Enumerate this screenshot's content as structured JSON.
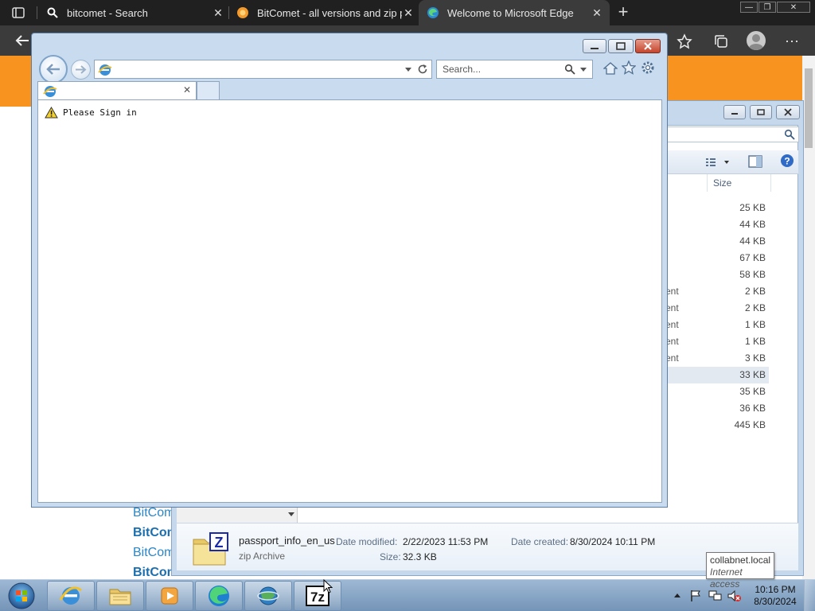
{
  "edge": {
    "tabs": [
      {
        "title": "bitcomet - Search",
        "close": "✕"
      },
      {
        "title": "BitComet - all versions and zip p",
        "close": "✕"
      },
      {
        "title": "Welcome to Microsoft Edge",
        "close": "✕"
      }
    ],
    "new_tab": "+",
    "window_controls": [
      "—",
      "❐",
      "✕"
    ],
    "page_links": [
      {
        "text": "BitCom",
        "bold": false
      },
      {
        "text": "BitCom",
        "bold": true
      },
      {
        "text": "BitCom",
        "bold": false
      },
      {
        "text": "BitCom",
        "bold": true
      }
    ]
  },
  "explorer": {
    "column_header": "Size",
    "rows": [
      {
        "frag": "",
        "size": "25 KB"
      },
      {
        "frag": "",
        "size": "44 KB"
      },
      {
        "frag": "",
        "size": "44 KB"
      },
      {
        "frag": "",
        "size": "67 KB"
      },
      {
        "frag": "",
        "size": "58 KB"
      },
      {
        "frag": "ent",
        "size": "2 KB"
      },
      {
        "frag": "ent",
        "size": "2 KB"
      },
      {
        "frag": "ent",
        "size": "1 KB"
      },
      {
        "frag": "ent",
        "size": "1 KB"
      },
      {
        "frag": "ent",
        "size": "3 KB"
      },
      {
        "frag": "",
        "size": "33 KB",
        "selected": true
      },
      {
        "frag": "",
        "size": "35 KB"
      },
      {
        "frag": "",
        "size": "36 KB"
      },
      {
        "frag": "",
        "size": "445 KB"
      }
    ],
    "details": {
      "name": "passport_info_en_us",
      "type": "zip Archive",
      "date_modified_label": "Date modified:",
      "date_modified": "2/22/2023 11:53 PM",
      "size_label": "Size:",
      "size": "32.3 KB",
      "date_created_label": "Date created:",
      "date_created": "8/30/2024 10:11 PM"
    }
  },
  "ie": {
    "address_value": "",
    "search_placeholder": "Search...",
    "tab_title": "",
    "tab_close": "✕",
    "message": "Please Sign in"
  },
  "taskbar": {
    "clock_time": "10:16 PM",
    "clock_date": "8/30/2024",
    "tooltip_line1": "collabnet.local",
    "tooltip_line2": "Internet access"
  },
  "colors": {
    "edge_dark": "#202020",
    "edge_orange": "#f7931e",
    "ie_frame": "#c8dbef",
    "taskbar": "#7494b7"
  }
}
